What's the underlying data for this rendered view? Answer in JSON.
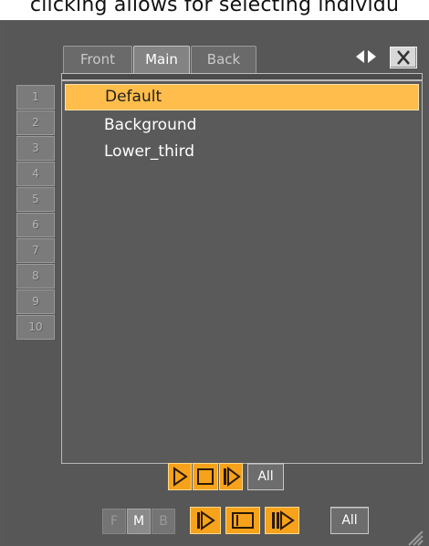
{
  "caption": "clicking allows for selecting individu",
  "tabs": [
    {
      "label": "Front",
      "active": false
    },
    {
      "label": "Main",
      "active": true
    },
    {
      "label": "Back",
      "active": false
    }
  ],
  "icons": {
    "resize_arrows": "left-right-arrows-icon",
    "close": "close-icon",
    "play": "play-icon",
    "stop": "stop-icon",
    "continue": "continue-icon",
    "resize_grip": "resize-grip-icon"
  },
  "layers": [
    "1",
    "2",
    "3",
    "4",
    "5",
    "6",
    "7",
    "8",
    "9",
    "10"
  ],
  "scenes": [
    {
      "label": "Default",
      "selected": true
    },
    {
      "label": "Background",
      "selected": false
    },
    {
      "label": "Lower_third",
      "selected": false
    }
  ],
  "controls": {
    "all_label": "All",
    "fmb": [
      {
        "label": "F",
        "on": false
      },
      {
        "label": "M",
        "on": true
      },
      {
        "label": "B",
        "on": false
      }
    ],
    "all_label_bottom": "All"
  },
  "colors": {
    "accent": "#f7a21b",
    "selection": "#ffbd4c",
    "panel": "#575757"
  }
}
